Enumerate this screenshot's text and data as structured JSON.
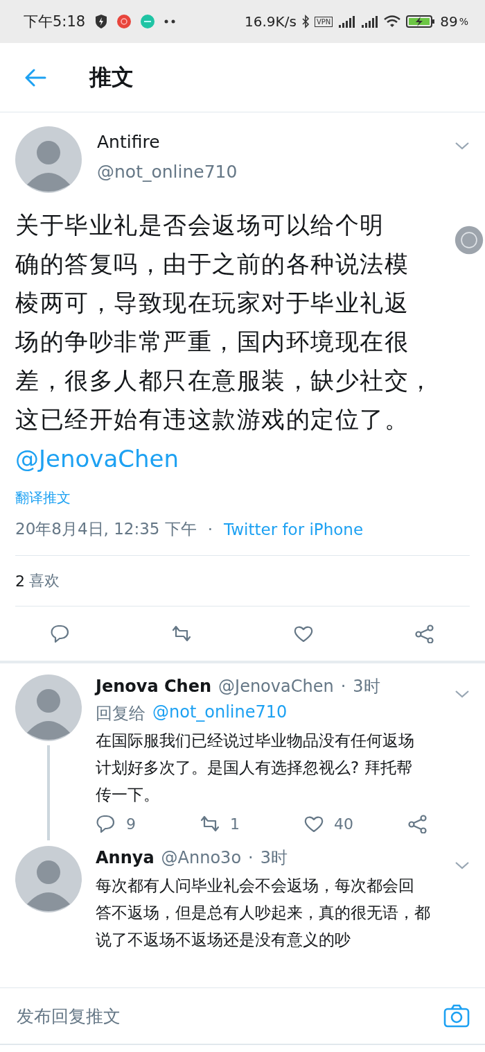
{
  "status_bar": {
    "time": "下午5:18",
    "speed": "16.9K/s",
    "vpn": "VPN",
    "battery": "89",
    "battery_unit": "%"
  },
  "header": {
    "title": "推文"
  },
  "tweet": {
    "name": "Antifire",
    "handle": "@not_online710",
    "text_lines": [
      "关于毕业礼是否会返场可以给个明",
      "确的答复吗，由于之前的各种说法模",
      "棱两可，导致现在玩家对于毕业礼返",
      "场的争吵非常严重，国内环境现在很",
      "差，很多人都只在意服装，缺少社交，",
      "这已经开始有违这款游戏的定位了。"
    ],
    "mention": "@JenovaChen",
    "translate": "翻译推文",
    "date": "20年8月4日, 12:35 下午",
    "separator": "·",
    "source": "Twitter for iPhone",
    "likes_count": "2",
    "likes_label": "喜欢"
  },
  "replies": [
    {
      "name": "Jenova Chen",
      "handle": "@JenovaChen",
      "separator": "·",
      "time": "3时",
      "reply_to_label": "回复给",
      "reply_to": "@not_online710",
      "thread_line": true,
      "text_lines": [
        "在国际服我们已经说过毕业物品没有任何返场",
        "计划好多次了。是国人有选择忽视么? 拜托帮",
        "传一下。"
      ],
      "replies": "9",
      "retweets": "1",
      "likes": "40"
    },
    {
      "name": "Annya",
      "handle": "@Anno3o",
      "separator": "·",
      "time": "3时",
      "thread_line": false,
      "text_lines": [
        "每次都有人问毕业礼会不会返场，每次都会回",
        "答不返场，但是总有人吵起来，真的很无语，都",
        "说了不返场不返场还是没有意义的吵"
      ]
    }
  ],
  "compose": {
    "placeholder": "发布回复推文"
  }
}
